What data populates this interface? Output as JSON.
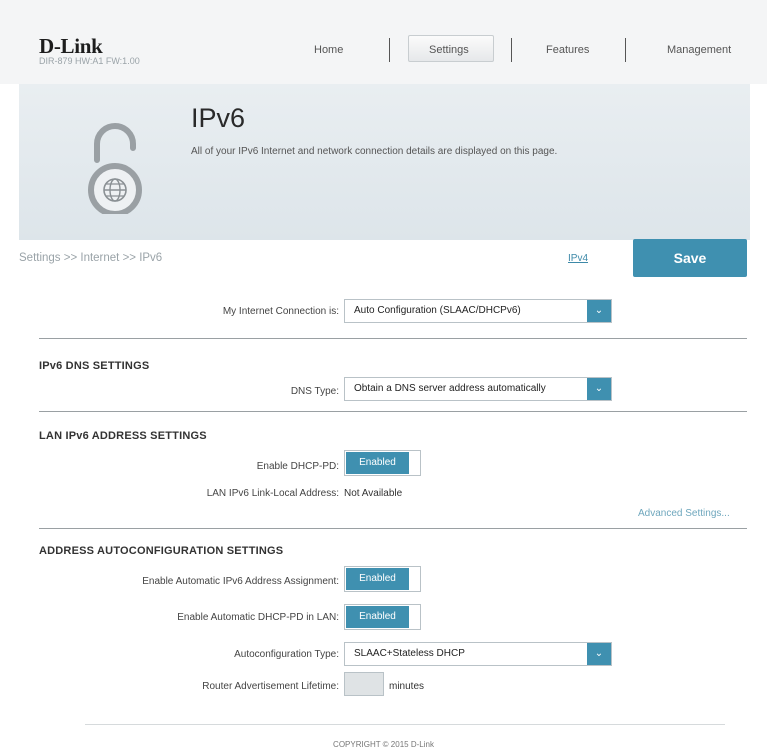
{
  "header": {
    "brand": "D-Link",
    "model": "DIR-879 HW:A1 FW:1.00",
    "nav": [
      "Home",
      "Settings",
      "Features",
      "Management"
    ]
  },
  "banner": {
    "title": "IPv6",
    "description": "All of your IPv6 Internet and network connection details are displayed on this page.",
    "icon": "lock-globe-icon"
  },
  "breadcrumb": "Settings >> Internet >> IPv6",
  "ipv4_link": "IPv4",
  "save_label": "Save",
  "connection": {
    "label": "My Internet Connection is:",
    "value": "Auto Configuration (SLAAC/DHCPv6)"
  },
  "dns": {
    "section": "IPv6 DNS SETTINGS",
    "type_label": "DNS Type:",
    "type_value": "Obtain a DNS server address automatically"
  },
  "lan": {
    "section": "LAN IPv6 ADDRESS SETTINGS",
    "dhcp_pd_label": "Enable DHCP-PD:",
    "dhcp_pd_value": "Enabled",
    "link_local_label": "LAN IPv6 Link-Local Address:",
    "link_local_value": "Not Available",
    "advanced": "Advanced Settings..."
  },
  "autoconf": {
    "section": "ADDRESS AUTOCONFIGURATION SETTINGS",
    "auto_assign_label": "Enable Automatic IPv6 Address Assignment:",
    "auto_assign_value": "Enabled",
    "auto_pd_label": "Enable Automatic DHCP-PD in LAN:",
    "auto_pd_value": "Enabled",
    "type_label": "Autoconfiguration Type:",
    "type_value": "SLAAC+Stateless DHCP",
    "lifetime_label": "Router Advertisement Lifetime:",
    "lifetime_unit": "minutes"
  },
  "footer": "COPYRIGHT © 2015 D-Link",
  "colors": {
    "accent": "#3f90b0",
    "banner": "#e4eaee"
  }
}
